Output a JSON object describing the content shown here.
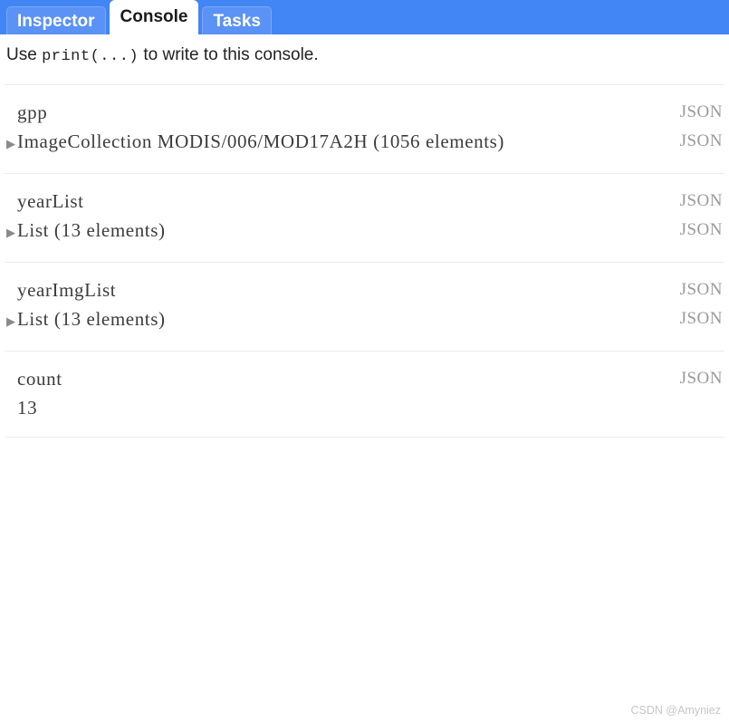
{
  "tabs": [
    {
      "label": "Inspector",
      "active": false
    },
    {
      "label": "Console",
      "active": true
    },
    {
      "label": "Tasks",
      "active": false
    }
  ],
  "console": {
    "hint_prefix": "Use ",
    "hint_code": "print(...)",
    "hint_suffix": " to write to this console.",
    "json_link_label": "JSON",
    "expander_glyph": "▶"
  },
  "entries": [
    {
      "label": "gpp",
      "value": "ImageCollection MODIS/006/MOD17A2H (1056 elements)",
      "expandable": true,
      "label_json": "JSON",
      "value_json": "JSON"
    },
    {
      "label": "yearList",
      "value": "List (13 elements)",
      "expandable": true,
      "label_json": "JSON",
      "value_json": "JSON"
    },
    {
      "label": "yearImgList",
      "value": "List (13 elements)",
      "expandable": true,
      "label_json": "JSON",
      "value_json": "JSON"
    },
    {
      "label": "count",
      "value": "13",
      "expandable": false,
      "label_json": "JSON",
      "value_json": ""
    }
  ],
  "watermark": "CSDN @Amyniez",
  "colors": {
    "header_blue": "#4285f4",
    "tab_inactive_blue": "#5b92f5",
    "divider": "#ececec",
    "text": "#3c3c3c",
    "json_gray": "#9a9a9a"
  }
}
